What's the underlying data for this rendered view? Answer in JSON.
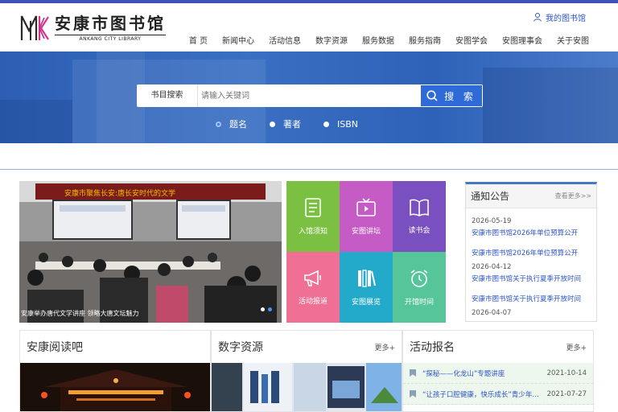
{
  "brand": {
    "name_cn": "安康市图书馆",
    "name_en": "ANKANG CITY LIBRARY"
  },
  "header": {
    "my_library": "我的图书馆"
  },
  "nav": [
    "首 页",
    "新闻中心",
    "活动信息",
    "数字资源",
    "服务数据",
    "服务指南",
    "安图学会",
    "安图理事会",
    "关于安图"
  ],
  "search": {
    "type_label": "书目搜索",
    "placeholder": "请输入关键词",
    "button": "搜 索",
    "options": [
      "题名",
      "著者",
      "ISBN"
    ],
    "selected": "题名"
  },
  "carousel": {
    "banner_text": "安康举办唐代文学讲座 领略大唐文坛魅力",
    "screen_text": "安康市聚焦长安:唐长安时代的文学",
    "caption": "安康举办唐代文学讲座 领略大唐文坛魅力"
  },
  "tiles": [
    {
      "label": "入馆须知",
      "icon": "document-list-icon",
      "color": "#7cc043"
    },
    {
      "label": "安图讲坛",
      "icon": "tv-play-icon",
      "color": "#c55bc4"
    },
    {
      "label": "读书会",
      "icon": "open-book-icon",
      "color": "#7a4fbf"
    },
    {
      "label": "活动报道",
      "icon": "megaphone-icon",
      "color": "#ef6f95"
    },
    {
      "label": "安图展览",
      "icon": "books-icon",
      "color": "#23a9c9"
    },
    {
      "label": "开馆时间",
      "icon": "alarm-clock-icon",
      "color": "#57c59a"
    }
  ],
  "notice": {
    "title": "通知公告",
    "more": "查看更多>>",
    "items": [
      {
        "date": "2026-05-19",
        "text": "安康市图书馆2026年单位预算公开"
      },
      {
        "date": "",
        "text": "安康市图书馆2026年单位预算公开"
      },
      {
        "date": "2026-04-12",
        "text": "安康市图书馆关于执行夏季开放时间"
      },
      {
        "date": "",
        "text": "安康市图书馆关于执行夏季开放时间"
      },
      {
        "date": "2026-04-07",
        "text": ""
      }
    ]
  },
  "panels": {
    "reading": {
      "title": "安康阅读吧"
    },
    "digital": {
      "title": "数字资源",
      "more": "更多+"
    },
    "signup": {
      "title": "活动报名",
      "more": "更多+",
      "items": [
        {
          "text": "“探秘——化龙山”专题讲座",
          "date": "2021-10-14"
        },
        {
          "text": "“让孩子口腔健康，快乐成长”青少年公益讲座",
          "date": "2021-07-27"
        }
      ]
    }
  }
}
